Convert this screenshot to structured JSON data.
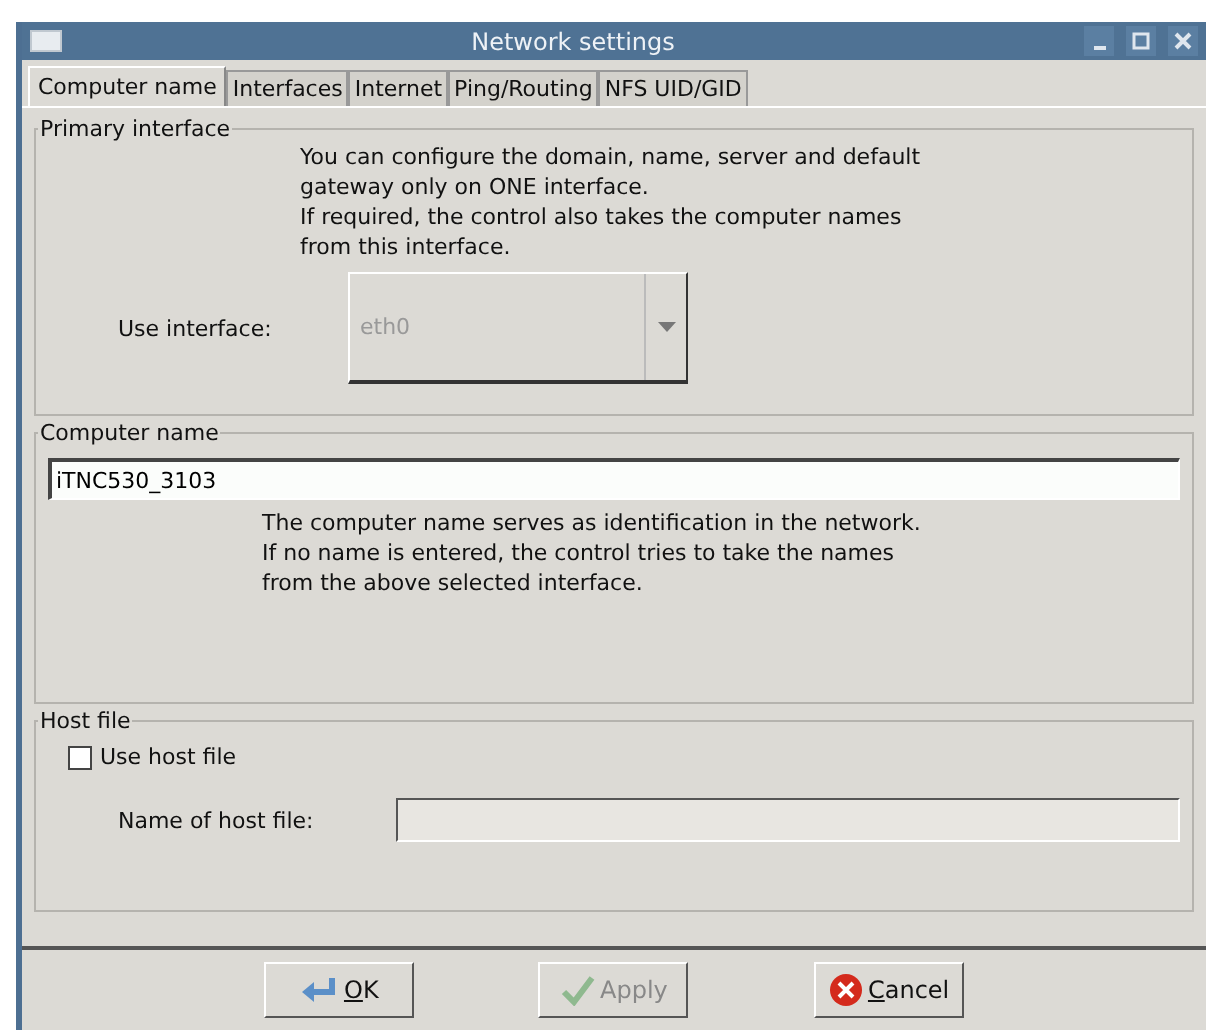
{
  "window": {
    "title": "Network settings"
  },
  "tabs": [
    {
      "label": "Computer name",
      "selected": true
    },
    {
      "label": "Interfaces",
      "selected": false
    },
    {
      "label": "Internet",
      "selected": false
    },
    {
      "label": "Ping/Routing",
      "selected": false
    },
    {
      "label": "NFS UID/GID",
      "selected": false
    }
  ],
  "primary_interface": {
    "title": "Primary interface",
    "description": [
      "You can configure the domain, name, server and default",
      "gateway only on ONE interface.",
      "If required, the control also takes the computer names",
      "from this interface."
    ],
    "label": "Use interface:",
    "dropdown": {
      "value": "eth0",
      "disabled": true
    }
  },
  "computer_name": {
    "title": "Computer name",
    "value": "iTNC530_3103",
    "description": [
      "The computer name serves as identification in the network.",
      "If no name is entered, the control tries to take the names",
      "from the above selected interface."
    ]
  },
  "host_file": {
    "title": "Host file",
    "checkbox": {
      "label": "Use host file",
      "checked": false
    },
    "label": "Name of host file:",
    "field": {
      "disabled": true
    }
  },
  "buttons": [
    {
      "kind": "ok",
      "label": "OK",
      "mnemonic": true,
      "disabled": false
    },
    {
      "kind": "apply",
      "label": "Apply",
      "mnemonic": false,
      "disabled": true
    },
    {
      "kind": "cancel",
      "label": "Cancel",
      "mnemonic": true,
      "disabled": false
    }
  ]
}
